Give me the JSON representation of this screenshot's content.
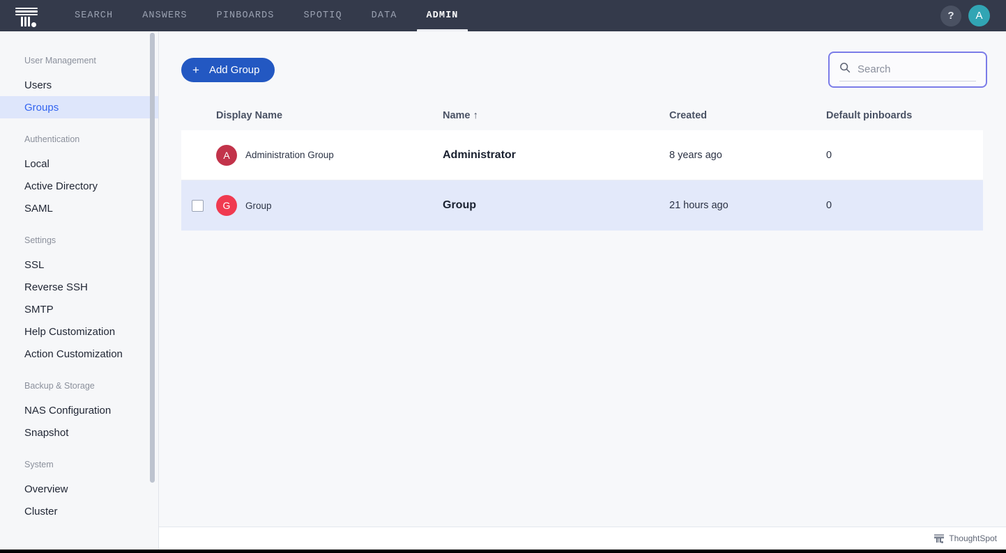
{
  "topnav": {
    "logo_name": "thoughtspot-logo",
    "tabs": [
      {
        "label": "SEARCH",
        "active": false
      },
      {
        "label": "ANSWERS",
        "active": false
      },
      {
        "label": "PINBOARDS",
        "active": false
      },
      {
        "label": "SPOTIQ",
        "active": false
      },
      {
        "label": "DATA",
        "active": false
      },
      {
        "label": "ADMIN",
        "active": true
      }
    ],
    "help_label": "?",
    "avatar_initial": "A",
    "avatar_color": "#31a5b4",
    "bg_color": "#343a4b"
  },
  "sidebar": {
    "sections": [
      {
        "label": "User Management",
        "items": [
          {
            "label": "Users",
            "active": false
          },
          {
            "label": "Groups",
            "active": true
          }
        ]
      },
      {
        "label": "Authentication",
        "items": [
          {
            "label": "Local",
            "active": false
          },
          {
            "label": "Active Directory",
            "active": false
          },
          {
            "label": "SAML",
            "active": false
          }
        ]
      },
      {
        "label": "Settings",
        "items": [
          {
            "label": "SSL",
            "active": false
          },
          {
            "label": "Reverse SSH",
            "active": false
          },
          {
            "label": "SMTP",
            "active": false
          },
          {
            "label": "Help Customization",
            "active": false
          },
          {
            "label": "Action Customization",
            "active": false
          }
        ]
      },
      {
        "label": "Backup & Storage",
        "items": [
          {
            "label": "NAS Configuration",
            "active": false
          },
          {
            "label": "Snapshot",
            "active": false
          }
        ]
      },
      {
        "label": "System",
        "items": [
          {
            "label": "Overview",
            "active": false
          },
          {
            "label": "Cluster",
            "active": false
          }
        ]
      }
    ],
    "active_color": "#3264f0",
    "active_bg": "#dee6fb"
  },
  "toolbar": {
    "add_group_label": "Add Group",
    "add_group_plus": "+",
    "add_group_color": "#2358c2",
    "search_placeholder": "Search",
    "search_value": "",
    "search_focus_color": "#7b7ce8"
  },
  "table": {
    "headers": {
      "display_name": "Display Name",
      "name": "Name",
      "sort_arrow": "↑",
      "created": "Created",
      "default_pinboards": "Default pinboards"
    },
    "rows": [
      {
        "selected": false,
        "checkbox_visible": false,
        "checked": false,
        "avatar_initial": "A",
        "avatar_color": "#c2334a",
        "display_name": "Administration Group",
        "name": "Administrator",
        "created": "8 years ago",
        "default_pinboards": "0"
      },
      {
        "selected": true,
        "checkbox_visible": true,
        "checked": false,
        "avatar_initial": "G",
        "avatar_color": "#f03a50",
        "display_name": "Group",
        "name": "Group",
        "created": "21 hours ago",
        "default_pinboards": "0"
      }
    ],
    "selected_row_color": "#e3e9fa"
  },
  "footer": {
    "brand": "ThoughtSpot"
  }
}
